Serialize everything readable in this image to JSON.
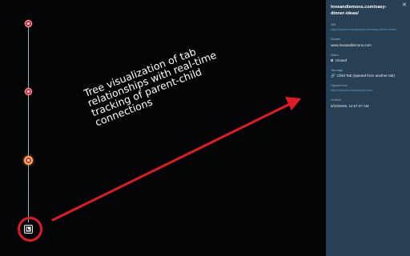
{
  "panel": {
    "title": "loveandlemons.com/easy-dinner-ideas/",
    "close_icon": "✕",
    "fields": [
      {
        "label": "URL",
        "value": "https://www.loveandlemons.com/easy-dinner-ideas/",
        "kind": "link"
      },
      {
        "label": "Domain",
        "value": "www.loveandlemons.com",
        "kind": "text"
      },
      {
        "label": "Status",
        "value": "Closed",
        "kind": "status"
      },
      {
        "label": "Tab origin",
        "value": "Child Tab (opened from another tab)",
        "kind": "parent"
      },
      {
        "label": "Opened from",
        "value": "https://www.loveandlemons.com/",
        "kind": "link"
      },
      {
        "label": "Created",
        "value": "6/10/2025, 11:57:37 AM",
        "kind": "text"
      }
    ]
  },
  "annotation": {
    "lines": [
      "Tree visualization of tab",
      "relationships with real-time",
      "tracking of parent-child",
      "connections"
    ]
  },
  "icons": {
    "link": "🔗",
    "tab_node": "tab-icon"
  },
  "colors": {
    "canvas_bg": "#030405",
    "panel_bg": "#284054",
    "node_red": "#d9232f",
    "node_amber_ring": "#ffb35c",
    "tree_line": "#8ab7bb",
    "annotation_red": "#e21a24",
    "link_blue": "#5e9fd2"
  }
}
